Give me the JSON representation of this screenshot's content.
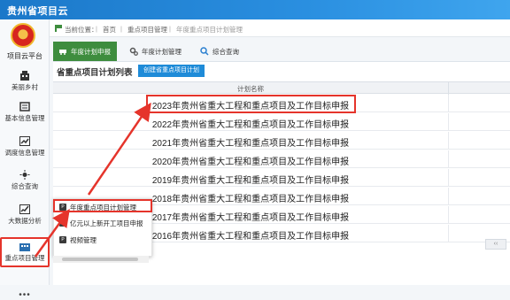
{
  "app": {
    "title": "贵州省项目云"
  },
  "sidebar": {
    "logo_label": "项目云平台",
    "items": [
      {
        "label": "美丽乡村",
        "icon": "building-icon"
      },
      {
        "label": "基本信息管理",
        "icon": "list-icon"
      },
      {
        "label": "调度信息管理",
        "icon": "trend-icon"
      },
      {
        "label": "综合查询",
        "icon": "sun-icon"
      },
      {
        "label": "大数据分析",
        "icon": "chart-icon"
      },
      {
        "label": "重点项目管理",
        "icon": "city-icon"
      }
    ],
    "more": "•••"
  },
  "breadcrumb": {
    "prefix": "当前位置：",
    "items": [
      "首页",
      "重点项目管理",
      "年度重点项目计划管理"
    ],
    "sep": "|"
  },
  "tabs": [
    {
      "label": "年度计划申报",
      "icon": "car-icon",
      "active": true
    },
    {
      "label": "年度计划管理",
      "icon": "gears-icon",
      "active": false
    },
    {
      "label": "综合查询",
      "icon": "search-icon",
      "active": false
    }
  ],
  "panel": {
    "title": "省重点项目计划列表",
    "create_label": "创建省重点项目计划",
    "column_header": "计划名称",
    "rows": [
      "2023年贵州省重大工程和重点项目及工作目标申报",
      "2022年贵州省重大工程和重点项目及工作目标申报",
      "2021年贵州省重大工程和重点项目及工作目标申报",
      "2020年贵州省重大工程和重点项目及工作目标申报",
      "2019年贵州省重大工程和重点项目及工作目标申报",
      "2018年贵州省重大工程和重点项目及工作目标申报",
      "2017年贵州省重大工程和重点项目及工作目标申报",
      "2016年贵州省重大工程和重点项目及工作目标申报"
    ],
    "pager_label": "‹‹"
  },
  "submenu": {
    "items": [
      "年度重点项目计划管理",
      "亿元以上新开工项目申报",
      "视频管理"
    ],
    "icon_glyph": "P"
  },
  "colors": {
    "accent": "#1e8bd8",
    "active_tab": "#3e8d3e",
    "highlight": "#e5342b"
  }
}
